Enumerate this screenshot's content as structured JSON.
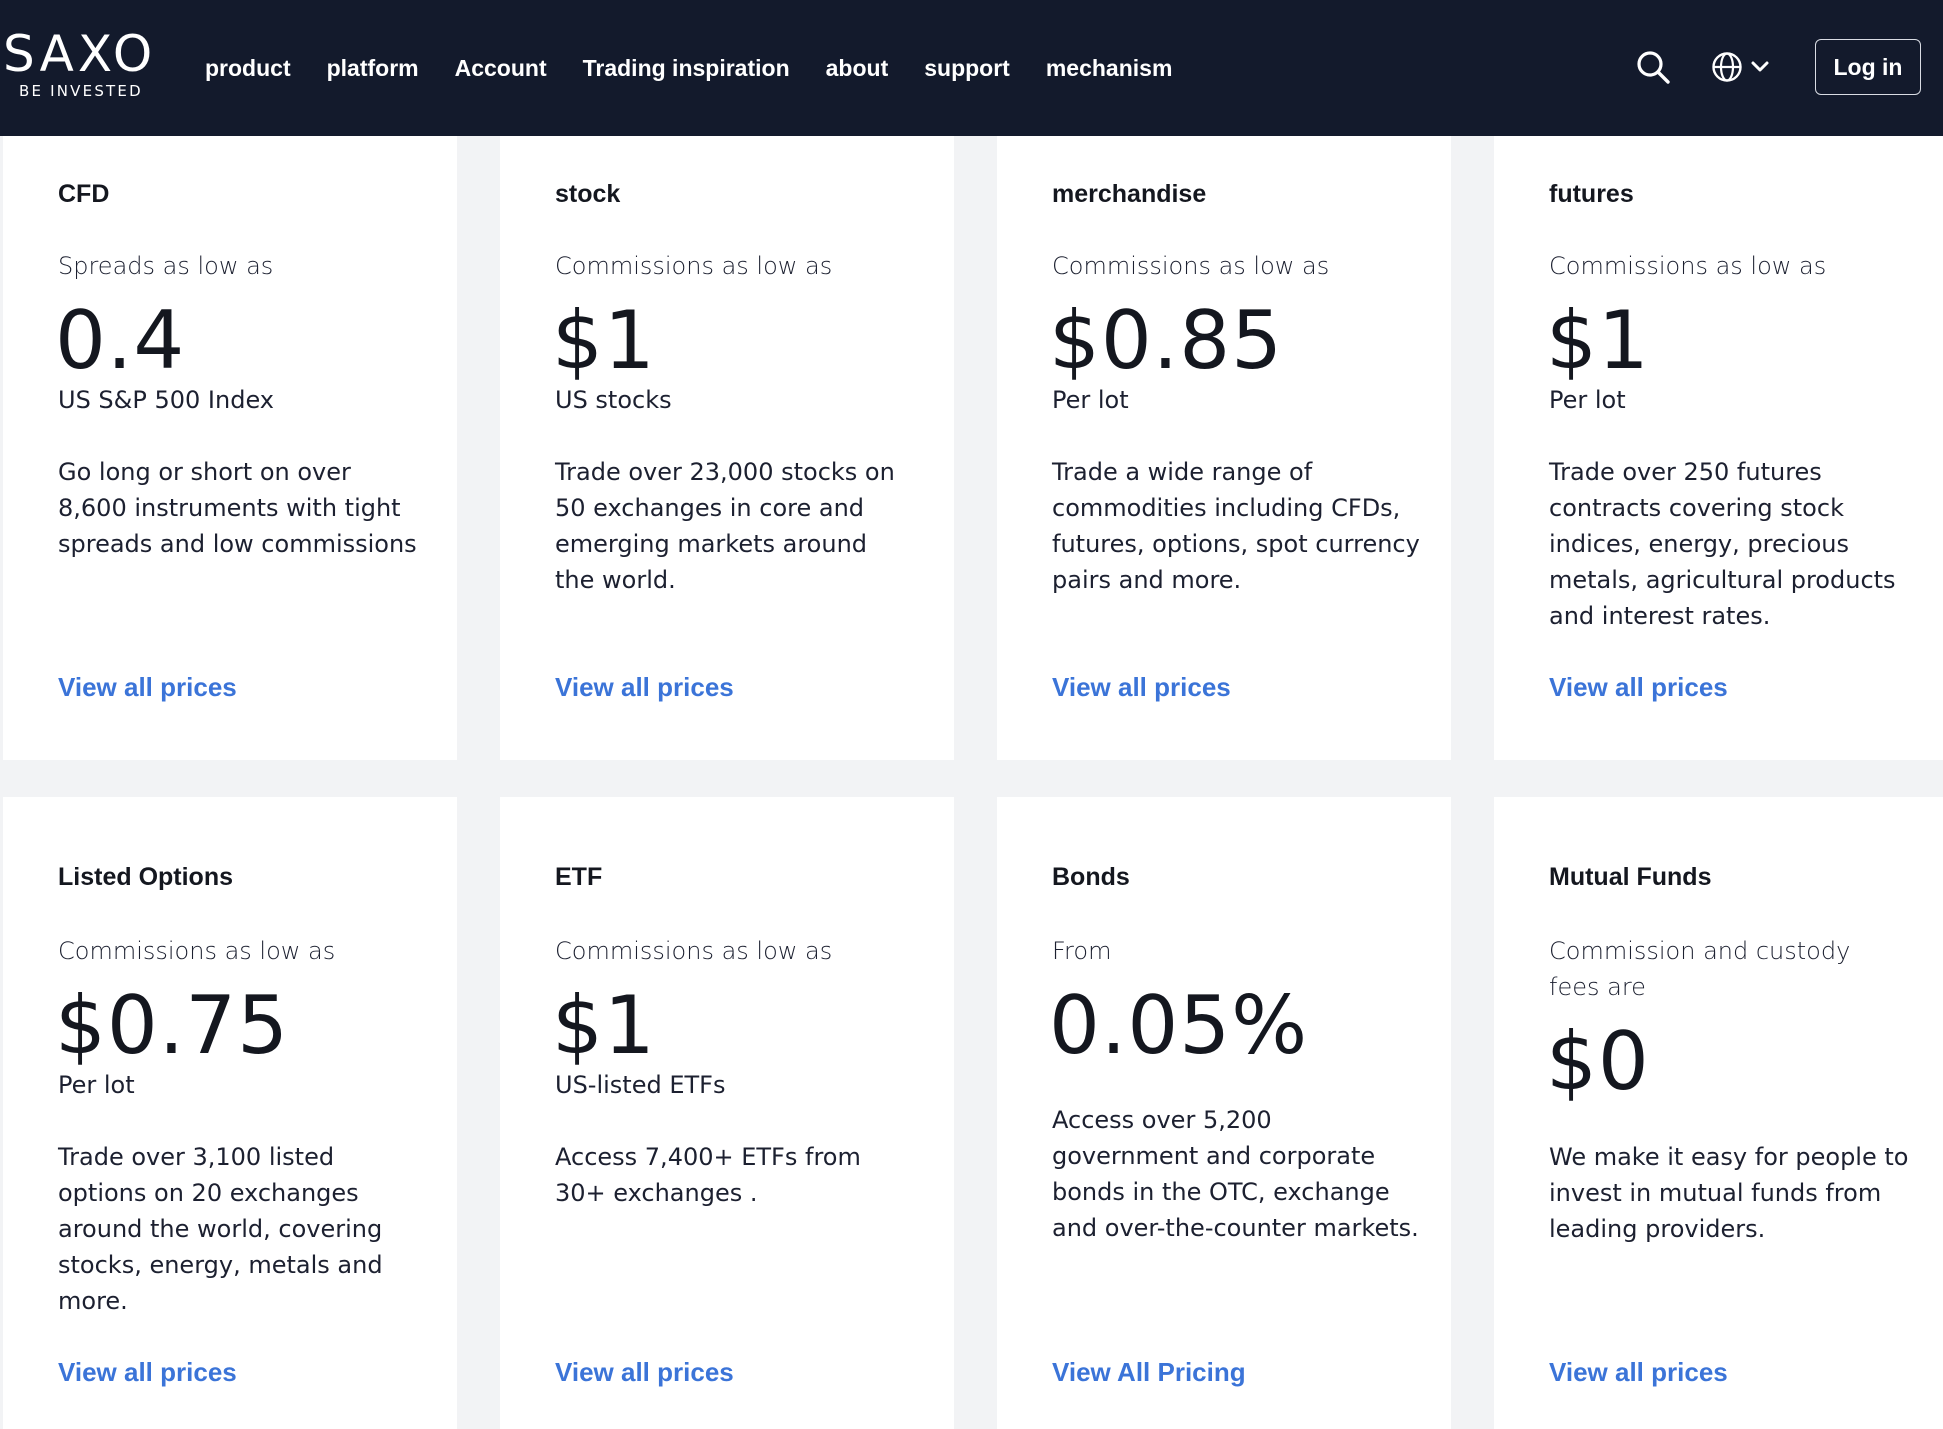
{
  "header": {
    "logo": {
      "word": "SAXO",
      "tagline": "BE INVESTED"
    },
    "nav": [
      "product",
      "platform",
      "Account",
      "Trading inspiration",
      "about",
      "support",
      "mechanism"
    ],
    "icons": {
      "search": "search-icon",
      "language": "globe-icon",
      "dropdown": "chevron-down-icon"
    },
    "login_label": "Log in",
    "colors": {
      "background": "#131a2c",
      "text": "#ffffff"
    }
  },
  "accent_color": "#3b74d8",
  "cards": [
    {
      "title": "CFD",
      "intro": "Spreads as low as",
      "price": "0.4",
      "unit": "US S&P 500 Index",
      "description": "Go long or short on over 8,600 instruments with tight spreads and low commissions",
      "link": "View all prices"
    },
    {
      "title": "stock",
      "intro": "Commissions as low as",
      "price": "$1",
      "unit": "US stocks",
      "description": "Trade over 23,000 stocks on 50 exchanges in core and emerging markets around the world.",
      "link": "View all prices"
    },
    {
      "title": "merchandise",
      "intro": "Commissions as low as",
      "price": "$0.85",
      "unit": "Per lot",
      "description": "Trade a wide range of commodities including CFDs, futures, options, spot currency pairs and more.",
      "link": "View all prices"
    },
    {
      "title": "futures",
      "intro": "Commissions as low as",
      "price": "$1",
      "unit": "Per lot",
      "description": "Trade over 250 futures contracts covering stock indices, energy, precious metals, agricultural products and interest rates.",
      "link": "View all prices"
    },
    {
      "title": "Listed Options",
      "intro": "Commissions as low as",
      "price": "$0.75",
      "unit": "Per lot",
      "description": "Trade over 3,100 listed options on 20 exchanges around the world, covering stocks, energy, metals and more.",
      "link": "View all prices"
    },
    {
      "title": "ETF",
      "intro": "Commissions as low as",
      "price": "$1",
      "unit": "US-listed ETFs",
      "description": "Access 7,400+ ETFs from 30+ exchanges .",
      "link": "View all prices"
    },
    {
      "title": "Bonds",
      "intro": "From",
      "price": "0.05%",
      "unit": "",
      "description": "Access over 5,200  government and corporate bonds in the OTC, exchange and over-the-counter markets.",
      "link": "View All Pricing"
    },
    {
      "title": "Mutual Funds",
      "intro": "Commission and custody fees are",
      "price": "$0",
      "unit": "",
      "description": "We make it easy for people to invest in mutual funds from leading providers.",
      "link": "View all prices"
    }
  ]
}
